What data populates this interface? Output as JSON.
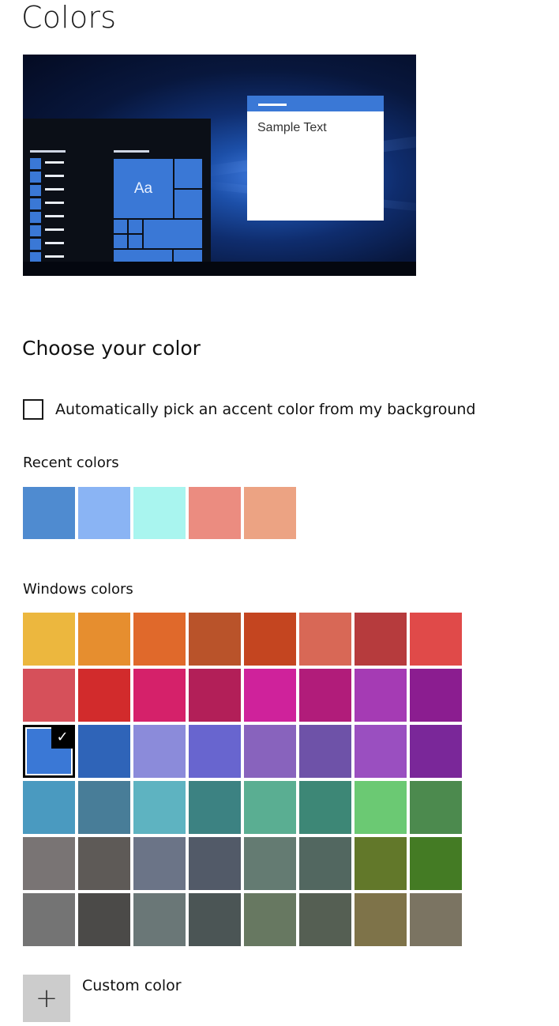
{
  "page": {
    "title": "Colors"
  },
  "preview": {
    "sample_text": "Sample Text",
    "tile_text": "Aa",
    "accent": "#3a78d6"
  },
  "choose": {
    "title": "Choose your color",
    "auto_pick_label": "Automatically pick an accent color from my background",
    "auto_pick_checked": false
  },
  "recent": {
    "title": "Recent colors",
    "colors": [
      "#4f8bd0",
      "#8ab4f4",
      "#a9f5ef",
      "#eb8c80",
      "#eca383"
    ]
  },
  "windows_colors": {
    "title": "Windows colors",
    "selected_index": 16,
    "colors": [
      "#ecb73e",
      "#e68e2f",
      "#e0692b",
      "#b9532a",
      "#c44520",
      "#d86856",
      "#b63b3d",
      "#e04a49",
      "#d6505a",
      "#d22b2c",
      "#d5216a",
      "#b21f58",
      "#cf229b",
      "#b11c7a",
      "#a53bb4",
      "#8b1d90",
      "#3a78d6",
      "#2f64b8",
      "#8b8bda",
      "#6865cf",
      "#8863bd",
      "#6e52a8",
      "#9a4fc0",
      "#7a2799",
      "#4a9ac0",
      "#487d98",
      "#5eb3c1",
      "#3c8282",
      "#5aae92",
      "#3d8776",
      "#6bc973",
      "#4c8a4e",
      "#797474",
      "#5e5a57",
      "#6b7487",
      "#525a68",
      "#647b72",
      "#526760",
      "#62782a",
      "#447b24",
      "#747474",
      "#4b4a48",
      "#6a7777",
      "#4b5555",
      "#677861",
      "#555f53",
      "#7e7349",
      "#7b7462"
    ]
  },
  "custom": {
    "label": "Custom color",
    "button_symbol": "+"
  },
  "icons": {
    "check": "✓"
  }
}
